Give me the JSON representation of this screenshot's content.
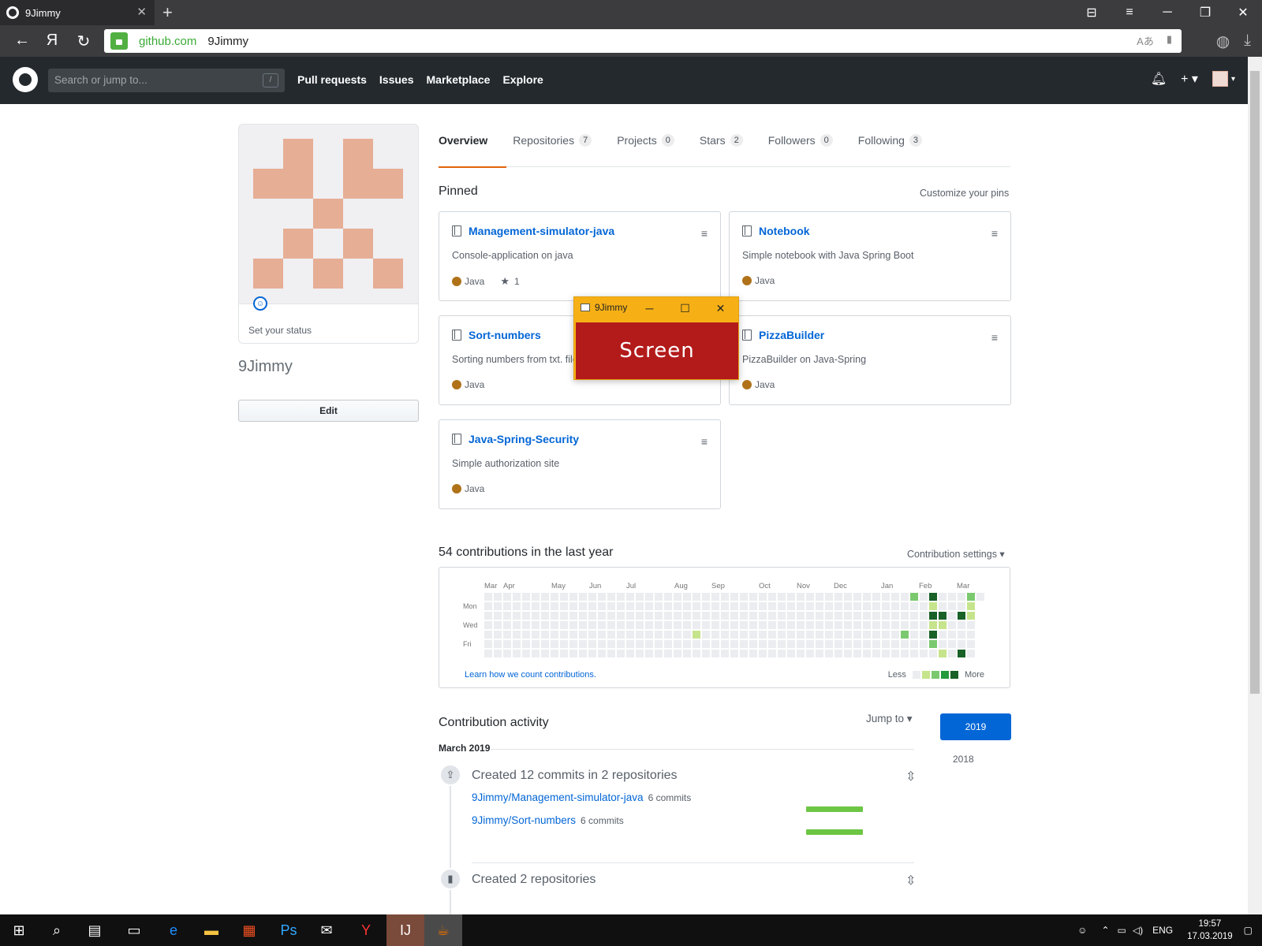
{
  "browser": {
    "tab_title": "9Jimmy",
    "tab_close": "✕",
    "new_tab": "+",
    "url_domain": "github.com",
    "url_path": "9Jimmy",
    "nav_back": "←",
    "nav_home": "Я",
    "nav_reload": "↻"
  },
  "github_header": {
    "search_placeholder": "Search or jump to...",
    "search_shortcut": "/",
    "nav": [
      "Pull requests",
      "Issues",
      "Marketplace",
      "Explore"
    ]
  },
  "profile": {
    "status_text": "Set your status",
    "username": "9Jimmy",
    "edit_label": "Edit"
  },
  "tabs": [
    {
      "label": "Overview",
      "count": ""
    },
    {
      "label": "Repositories",
      "count": "7"
    },
    {
      "label": "Projects",
      "count": "0"
    },
    {
      "label": "Stars",
      "count": "2"
    },
    {
      "label": "Followers",
      "count": "0"
    },
    {
      "label": "Following",
      "count": "3"
    }
  ],
  "pinned": {
    "title": "Pinned",
    "customize": "Customize your pins",
    "repos": [
      {
        "name": "Management-simulator-java",
        "desc": "Console-application on java",
        "lang": "Java",
        "stars": "1"
      },
      {
        "name": "Notebook",
        "desc": "Simple notebook with Java Spring Boot",
        "lang": "Java",
        "stars": ""
      },
      {
        "name": "Sort-numbers",
        "desc": "Sorting numbers from txt. file",
        "lang": "Java",
        "stars": ""
      },
      {
        "name": "PizzaBuilder",
        "desc": "PizzaBuilder on Java-Spring",
        "lang": "Java",
        "stars": ""
      },
      {
        "name": "Java-Spring-Security",
        "desc": "Simple authorization site",
        "lang": "Java",
        "stars": ""
      }
    ],
    "lang_color": "#b07219"
  },
  "contributions": {
    "title": "54 contributions in the last year",
    "settings": "Contribution settings ▾",
    "months": [
      "Mar",
      "Apr",
      "May",
      "Jun",
      "Jul",
      "Aug",
      "Sep",
      "Oct",
      "Nov",
      "Dec",
      "Jan",
      "Feb",
      "Mar"
    ],
    "days": [
      "Mon",
      "Wed",
      "Fri"
    ],
    "learn": "Learn how we count contributions.",
    "less": "Less",
    "more": "More",
    "colors": [
      "#ebedf0",
      "#c6e48b",
      "#7bc96f",
      "#239a3b",
      "#196127"
    ]
  },
  "activity": {
    "title": "Contribution activity",
    "jump_to": "Jump to ▾",
    "years": [
      "2019",
      "2018"
    ],
    "month": "March 2019",
    "items": [
      {
        "heading": "Created 12 commits in 2 repositories"
      },
      {
        "heading": "Created 2 repositories"
      }
    ],
    "commit_repos": [
      {
        "repo": "9Jimmy/Management-simulator-java",
        "count": "6 commits"
      },
      {
        "repo": "9Jimmy/Sort-numbers",
        "count": "6 commits"
      }
    ]
  },
  "float_window": {
    "title": "9Jimmy",
    "body": "Screen"
  },
  "taskbar": {
    "lang": "ENG",
    "time": "19:57",
    "date": "17.03.2019"
  }
}
